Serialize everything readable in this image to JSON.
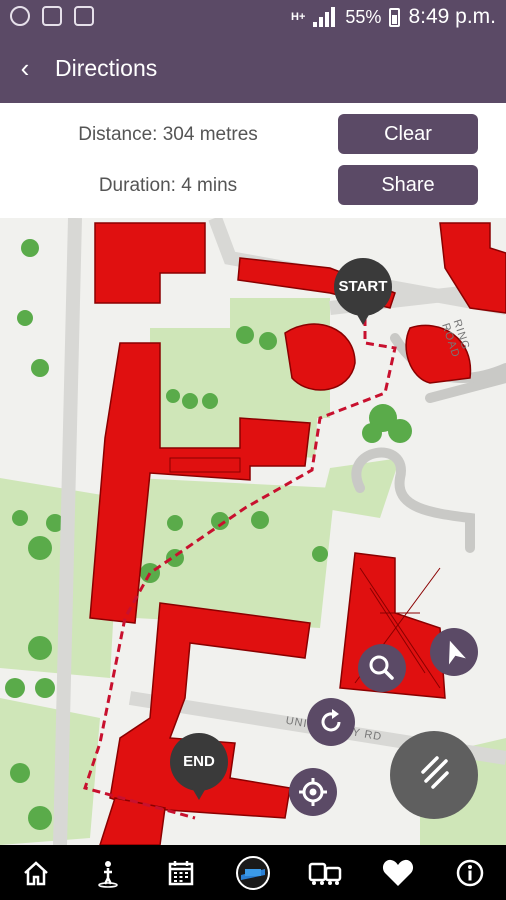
{
  "status_bar": {
    "network": "H+",
    "battery": "55%",
    "time": "8:49 p.m."
  },
  "app_bar": {
    "back_icon": "arrow-left-icon",
    "title": "Directions"
  },
  "route_info": {
    "distance": "Distance: 304 metres",
    "duration": "Duration: 4 mins"
  },
  "buttons": {
    "clear": "Clear",
    "share": "Share"
  },
  "map": {
    "start_label": "START",
    "end_label": "END",
    "road_ring": "RING ROAD",
    "road_university": "UNIVERSITY RD",
    "route_color": "#c8102e",
    "building_color": "#e01010"
  },
  "map_controls": {
    "search": "search-icon",
    "compass": "navigation-arrow-icon",
    "refresh": "refresh-icon",
    "locate": "locate-icon",
    "menu": "menu-icon"
  },
  "bottom_nav": [
    "home-icon",
    "walking-person-icon",
    "calendar-icon",
    "bus-logo-icon",
    "transit-icon",
    "heart-icon",
    "info-icon"
  ],
  "colors": {
    "primary": "#5b4a66",
    "nav_background": "#000000"
  }
}
